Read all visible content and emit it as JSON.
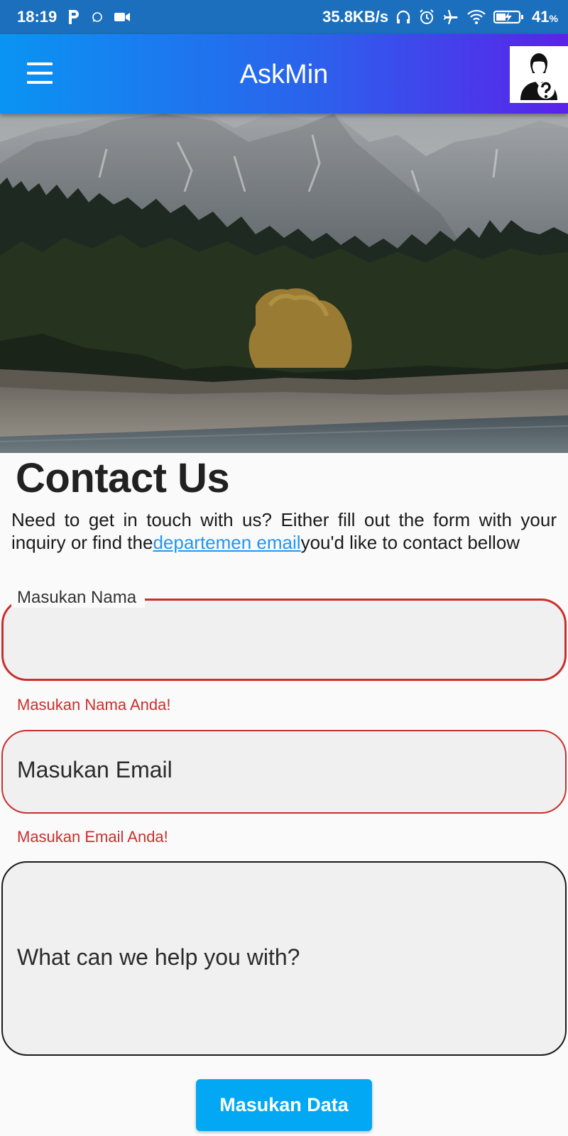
{
  "status_bar": {
    "time": "18:19",
    "net_speed": "35.8KB/s",
    "battery": "41",
    "battery_unit": "%",
    "icons": [
      "parking-icon",
      "whatsapp-icon",
      "video-icon",
      "headphones-icon",
      "alarm-icon",
      "airplane-icon",
      "wifi-icon",
      "battery-charging-icon"
    ]
  },
  "app_bar": {
    "title": "AskMin",
    "menu_icon": "hamburger-menu-icon",
    "avatar_icon": "user-question-icon",
    "gradient": [
      "#0a94f2",
      "#5a22ea"
    ]
  },
  "hero": {
    "image": "mountain-forest-lake-photo"
  },
  "contact": {
    "title": "Contact Us",
    "intro_before": "Need to get in touch with us? Either fill out the form with your inquiry or find the",
    "intro_link": "departemen email",
    "intro_after": "you'd like to contact bellow"
  },
  "form": {
    "name_label": "Masukan Nama",
    "name_value": "",
    "name_error": "Masukan Nama Anda!",
    "email_placeholder": "Masukan Email",
    "email_error": "Masukan Email Anda!",
    "message_placeholder": "What can we help you with?",
    "submit_label": "Masukan Data"
  },
  "colors": {
    "error": "#c9302c",
    "link": "#2196f3",
    "button": "#02a8f4"
  }
}
